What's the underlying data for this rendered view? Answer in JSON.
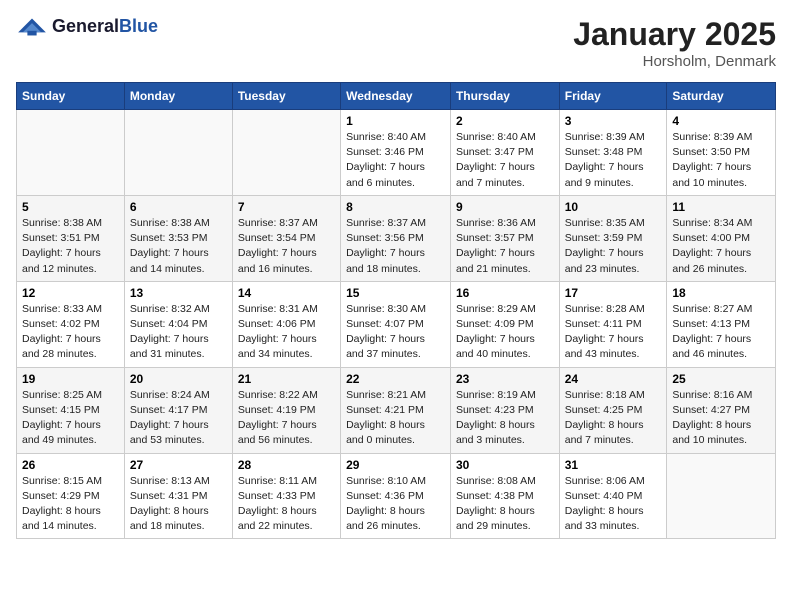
{
  "logo": {
    "general": "General",
    "blue": "Blue"
  },
  "title": "January 2025",
  "location": "Horsholm, Denmark",
  "days_header": [
    "Sunday",
    "Monday",
    "Tuesday",
    "Wednesday",
    "Thursday",
    "Friday",
    "Saturday"
  ],
  "weeks": [
    [
      {
        "day": "",
        "info": ""
      },
      {
        "day": "",
        "info": ""
      },
      {
        "day": "",
        "info": ""
      },
      {
        "day": "1",
        "info": "Sunrise: 8:40 AM\nSunset: 3:46 PM\nDaylight: 7 hours\nand 6 minutes."
      },
      {
        "day": "2",
        "info": "Sunrise: 8:40 AM\nSunset: 3:47 PM\nDaylight: 7 hours\nand 7 minutes."
      },
      {
        "day": "3",
        "info": "Sunrise: 8:39 AM\nSunset: 3:48 PM\nDaylight: 7 hours\nand 9 minutes."
      },
      {
        "day": "4",
        "info": "Sunrise: 8:39 AM\nSunset: 3:50 PM\nDaylight: 7 hours\nand 10 minutes."
      }
    ],
    [
      {
        "day": "5",
        "info": "Sunrise: 8:38 AM\nSunset: 3:51 PM\nDaylight: 7 hours\nand 12 minutes."
      },
      {
        "day": "6",
        "info": "Sunrise: 8:38 AM\nSunset: 3:53 PM\nDaylight: 7 hours\nand 14 minutes."
      },
      {
        "day": "7",
        "info": "Sunrise: 8:37 AM\nSunset: 3:54 PM\nDaylight: 7 hours\nand 16 minutes."
      },
      {
        "day": "8",
        "info": "Sunrise: 8:37 AM\nSunset: 3:56 PM\nDaylight: 7 hours\nand 18 minutes."
      },
      {
        "day": "9",
        "info": "Sunrise: 8:36 AM\nSunset: 3:57 PM\nDaylight: 7 hours\nand 21 minutes."
      },
      {
        "day": "10",
        "info": "Sunrise: 8:35 AM\nSunset: 3:59 PM\nDaylight: 7 hours\nand 23 minutes."
      },
      {
        "day": "11",
        "info": "Sunrise: 8:34 AM\nSunset: 4:00 PM\nDaylight: 7 hours\nand 26 minutes."
      }
    ],
    [
      {
        "day": "12",
        "info": "Sunrise: 8:33 AM\nSunset: 4:02 PM\nDaylight: 7 hours\nand 28 minutes."
      },
      {
        "day": "13",
        "info": "Sunrise: 8:32 AM\nSunset: 4:04 PM\nDaylight: 7 hours\nand 31 minutes."
      },
      {
        "day": "14",
        "info": "Sunrise: 8:31 AM\nSunset: 4:06 PM\nDaylight: 7 hours\nand 34 minutes."
      },
      {
        "day": "15",
        "info": "Sunrise: 8:30 AM\nSunset: 4:07 PM\nDaylight: 7 hours\nand 37 minutes."
      },
      {
        "day": "16",
        "info": "Sunrise: 8:29 AM\nSunset: 4:09 PM\nDaylight: 7 hours\nand 40 minutes."
      },
      {
        "day": "17",
        "info": "Sunrise: 8:28 AM\nSunset: 4:11 PM\nDaylight: 7 hours\nand 43 minutes."
      },
      {
        "day": "18",
        "info": "Sunrise: 8:27 AM\nSunset: 4:13 PM\nDaylight: 7 hours\nand 46 minutes."
      }
    ],
    [
      {
        "day": "19",
        "info": "Sunrise: 8:25 AM\nSunset: 4:15 PM\nDaylight: 7 hours\nand 49 minutes."
      },
      {
        "day": "20",
        "info": "Sunrise: 8:24 AM\nSunset: 4:17 PM\nDaylight: 7 hours\nand 53 minutes."
      },
      {
        "day": "21",
        "info": "Sunrise: 8:22 AM\nSunset: 4:19 PM\nDaylight: 7 hours\nand 56 minutes."
      },
      {
        "day": "22",
        "info": "Sunrise: 8:21 AM\nSunset: 4:21 PM\nDaylight: 8 hours\nand 0 minutes."
      },
      {
        "day": "23",
        "info": "Sunrise: 8:19 AM\nSunset: 4:23 PM\nDaylight: 8 hours\nand 3 minutes."
      },
      {
        "day": "24",
        "info": "Sunrise: 8:18 AM\nSunset: 4:25 PM\nDaylight: 8 hours\nand 7 minutes."
      },
      {
        "day": "25",
        "info": "Sunrise: 8:16 AM\nSunset: 4:27 PM\nDaylight: 8 hours\nand 10 minutes."
      }
    ],
    [
      {
        "day": "26",
        "info": "Sunrise: 8:15 AM\nSunset: 4:29 PM\nDaylight: 8 hours\nand 14 minutes."
      },
      {
        "day": "27",
        "info": "Sunrise: 8:13 AM\nSunset: 4:31 PM\nDaylight: 8 hours\nand 18 minutes."
      },
      {
        "day": "28",
        "info": "Sunrise: 8:11 AM\nSunset: 4:33 PM\nDaylight: 8 hours\nand 22 minutes."
      },
      {
        "day": "29",
        "info": "Sunrise: 8:10 AM\nSunset: 4:36 PM\nDaylight: 8 hours\nand 26 minutes."
      },
      {
        "day": "30",
        "info": "Sunrise: 8:08 AM\nSunset: 4:38 PM\nDaylight: 8 hours\nand 29 minutes."
      },
      {
        "day": "31",
        "info": "Sunrise: 8:06 AM\nSunset: 4:40 PM\nDaylight: 8 hours\nand 33 minutes."
      },
      {
        "day": "",
        "info": ""
      }
    ]
  ]
}
